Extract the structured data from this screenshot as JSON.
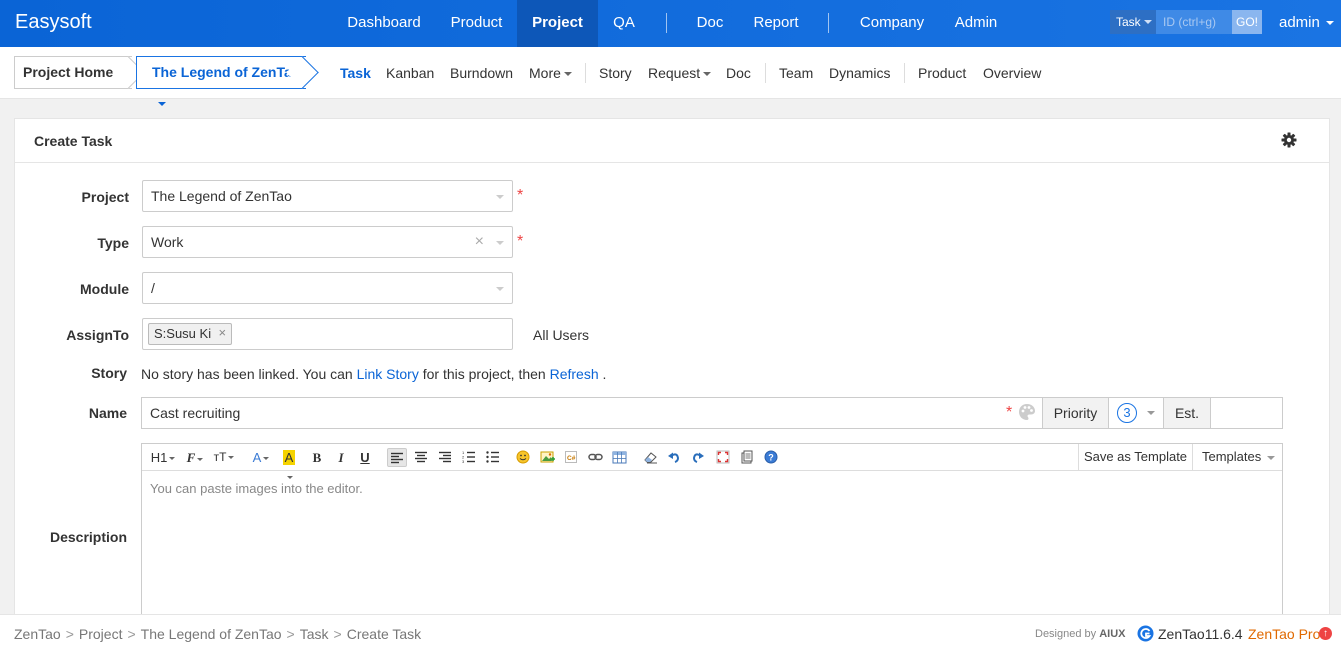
{
  "topbar": {
    "brand": "Easysoft",
    "nav": [
      "Dashboard",
      "Product",
      "Project",
      "QA",
      "Doc",
      "Report",
      "Company",
      "Admin"
    ],
    "active_nav": "Project",
    "search_type": "Task",
    "search_placeholder": "ID (ctrl+g)",
    "search_go": "GO!",
    "user": "admin"
  },
  "subnav": {
    "project_home": "Project Home",
    "project_name": "The Legend of ZenTao",
    "items": [
      "Task",
      "Kanban",
      "Burndown",
      "More",
      "Story",
      "Request",
      "Doc",
      "Team",
      "Dynamics",
      "Product",
      "Overview"
    ],
    "active_item": "Task"
  },
  "panel": {
    "title": "Create Task"
  },
  "form": {
    "project_label": "Project",
    "project_value": "The Legend of ZenTao",
    "type_label": "Type",
    "type_value": "Work",
    "module_label": "Module",
    "module_value": "/",
    "assign_label": "AssignTo",
    "assign_tag": "S:Susu Ki",
    "all_users": "All Users",
    "story_label": "Story",
    "story_text_before": "No story has been linked. You can",
    "story_link": "Link Story",
    "story_text_middle": "for this project, then",
    "story_refresh": "Refresh",
    "story_text_after": ".",
    "name_label": "Name",
    "name_value": "Cast recruiting",
    "priority_label": "Priority",
    "priority_value": "3",
    "est_label": "Est.",
    "description_label": "Description",
    "editor_placeholder": "You can paste images into the editor.",
    "save_template": "Save as Template",
    "templates": "Templates",
    "required_mark": "*"
  },
  "footer": {
    "breadcrumb": [
      "ZenTao",
      "Project",
      "The Legend of ZenTao",
      "Task",
      "Create Task"
    ],
    "breadcrumb_sep": ">",
    "designed_by": "Designed by",
    "designed_by_brand": "AIUX",
    "version": "ZenTao11.6.4",
    "pro": "ZenTao Pro"
  },
  "colors": {
    "topbar": "#0a64d6",
    "active_nav": "#0d57b8",
    "link": "#0a64d6",
    "required": "#ee4444",
    "pro": "#e06900"
  }
}
